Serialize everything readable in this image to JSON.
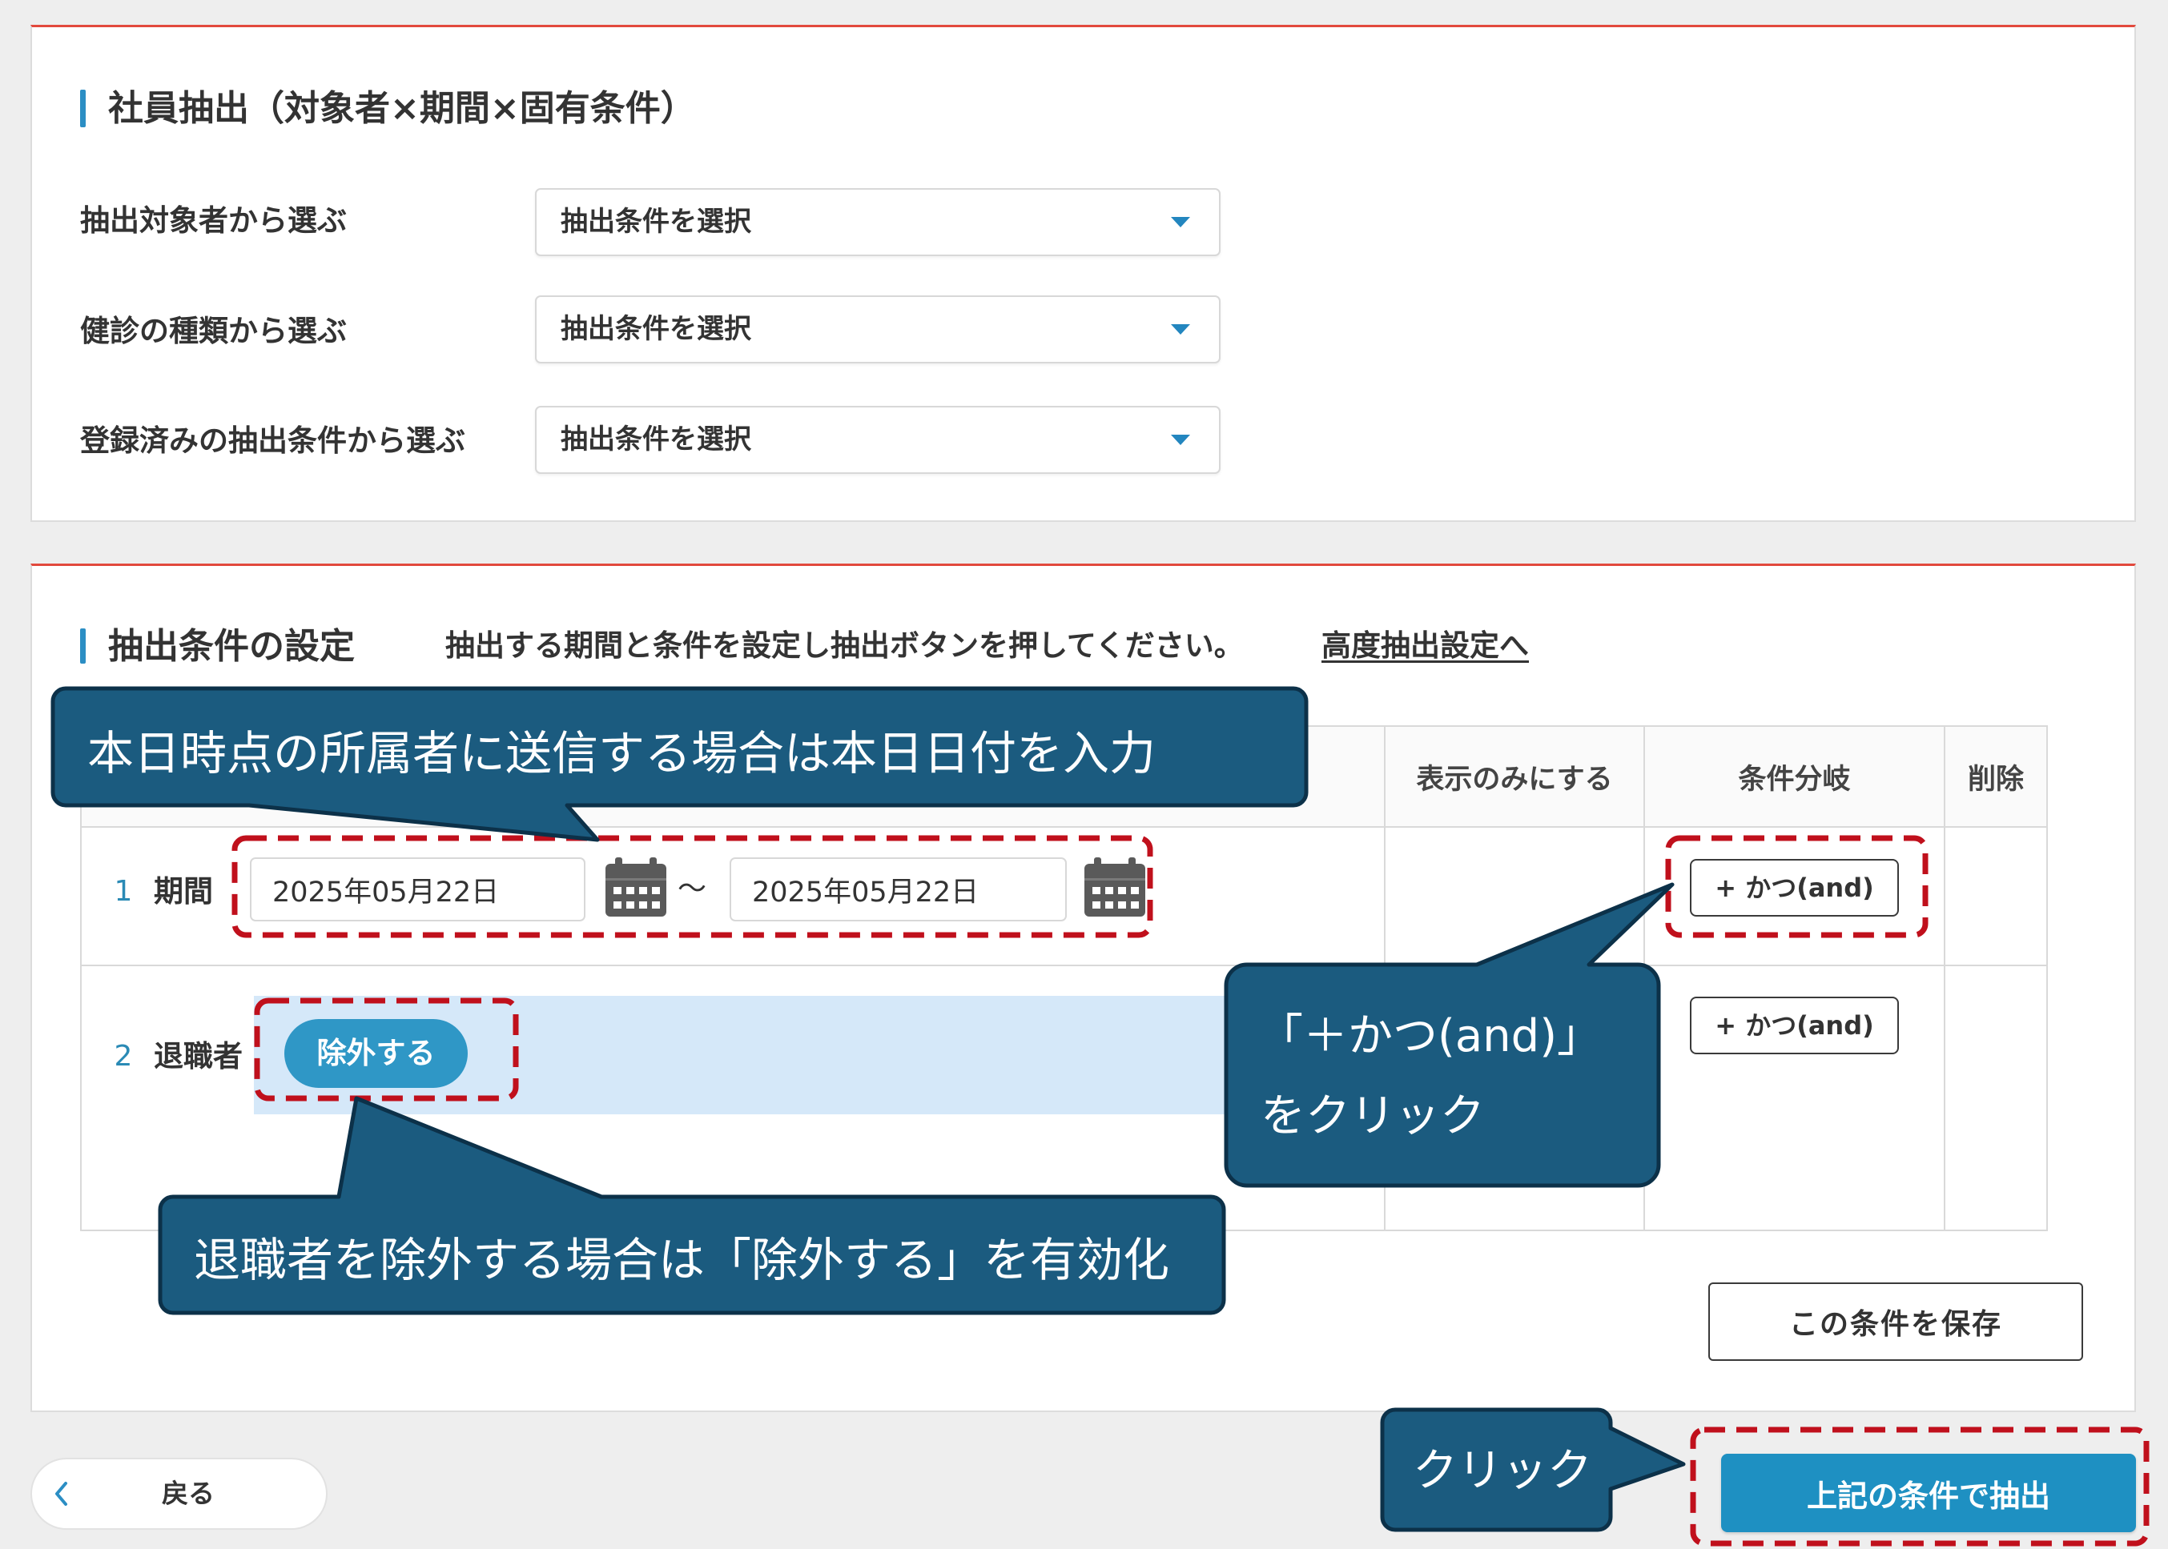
{
  "panel_employee": {
    "title": "社員抽出（対象者×期間×固有条件）",
    "rows": [
      {
        "label": "抽出対象者から選ぶ",
        "select_value": "抽出条件を選択"
      },
      {
        "label": "健診の種類から選ぶ",
        "select_value": "抽出条件を選択"
      },
      {
        "label": "登録済みの抽出条件から選ぶ",
        "select_value": "抽出条件を選択"
      }
    ]
  },
  "panel_conditions": {
    "title": "抽出条件の設定",
    "description": "抽出する期間と条件を設定し抽出ボタンを押してください。",
    "advanced_link": "高度抽出設定へ",
    "table": {
      "headers": {
        "display_only": "表示のみにする",
        "branch": "条件分岐",
        "delete": "削除"
      },
      "rows": [
        {
          "number": "1",
          "label": "期間",
          "date_from": "2025年05月22日",
          "range_separator": "〜",
          "date_to": "2025年05月22日",
          "branch_button": "+ かつ(and)"
        },
        {
          "number": "2",
          "label": "退職者",
          "exclude_toggle": {
            "label": "除外する",
            "active": true
          },
          "branch_button": "+ かつ(and)"
        }
      ]
    },
    "save_button": "この条件を保存"
  },
  "footer": {
    "back_button": "戻る",
    "extract_button": "上記の条件で抽出"
  },
  "annotations": {
    "date_hint": "本日時点の所属者に送信する場合は本日日付を入力",
    "and_hint": [
      "「＋かつ(and)」",
      "をクリック"
    ],
    "exclude_hint": "退職者を除外する場合は「除外する」を有効化",
    "extract_hint": "クリック"
  },
  "icons": {
    "dropdown": "caret-down-icon",
    "calendar": "calendar-icon",
    "back": "chevron-left-icon"
  },
  "colors": {
    "accent": "#2b8ec4",
    "panel_top_border": "#e2493d",
    "primary_button": "#1e90c2",
    "exclude_toggle": "#2f97c6",
    "row_highlight": "#d5e8f9",
    "annotation_highlight": "#c0101c",
    "callout_fill": "#1b5b7f"
  }
}
